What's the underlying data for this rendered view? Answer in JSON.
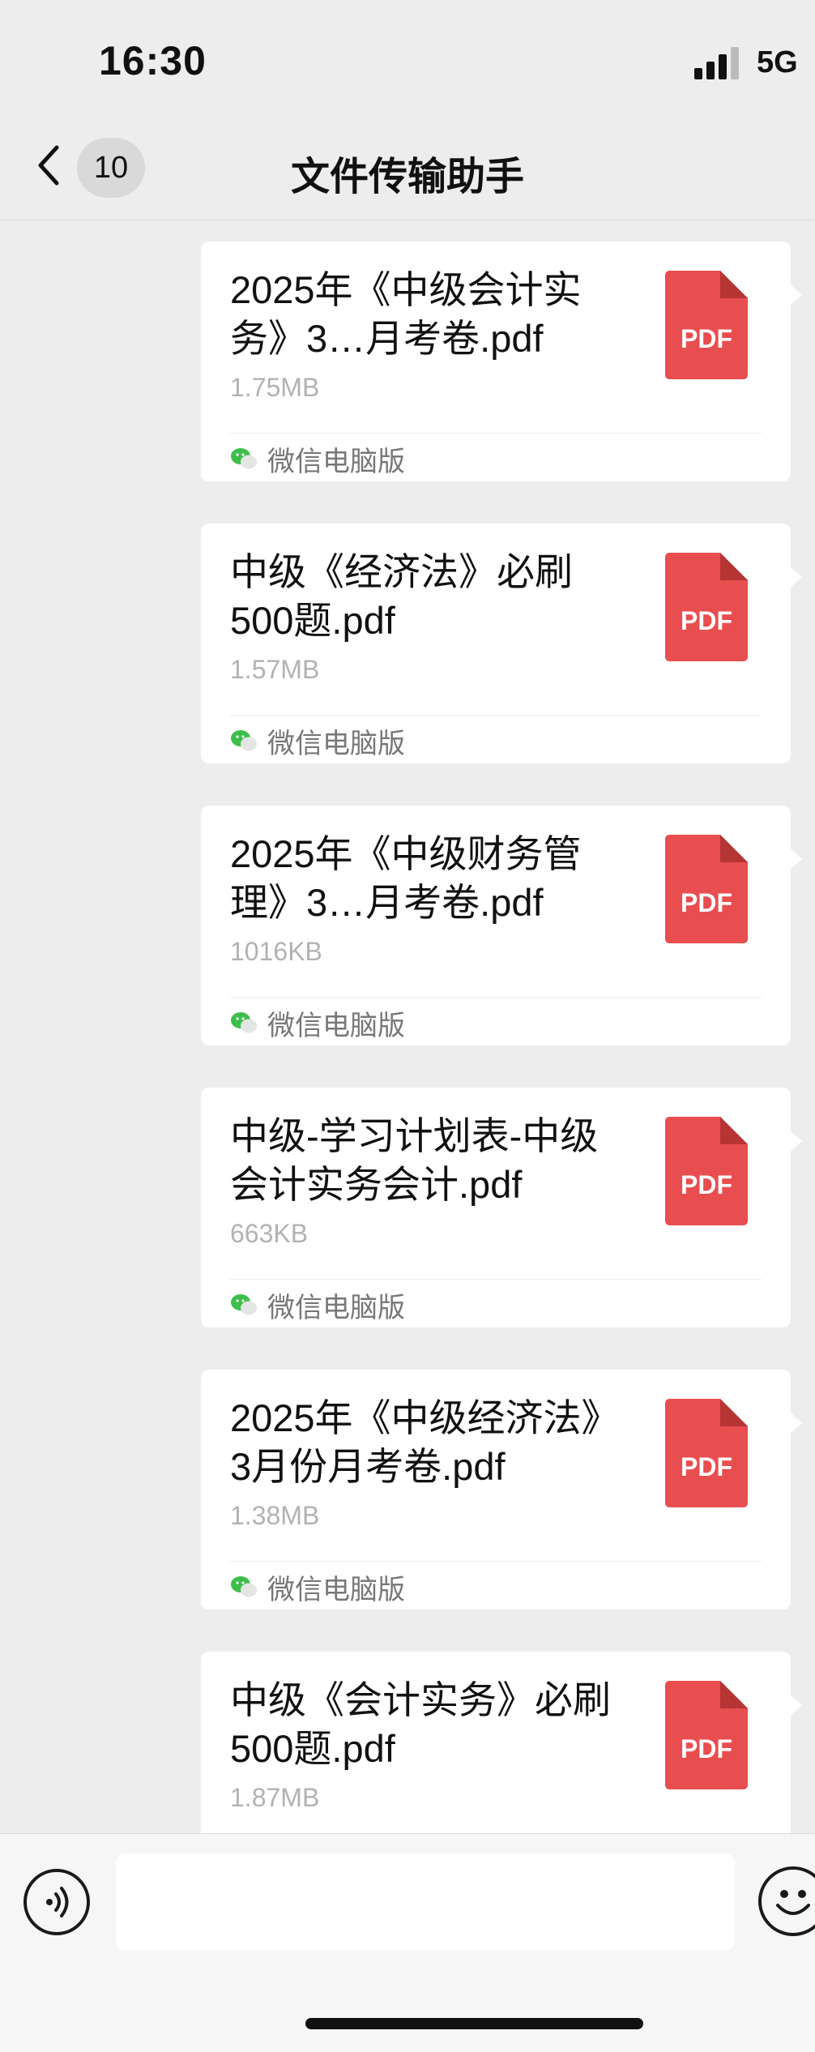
{
  "status_bar": {
    "time": "16:30",
    "network": "5G"
  },
  "nav": {
    "back_count": "10",
    "title": "文件传输助手"
  },
  "messages": [
    {
      "file_name": "2025年《中级会计实务》3…月考卷.pdf",
      "file_size": "1.75MB",
      "file_type": "PDF",
      "source": "微信电脑版"
    },
    {
      "file_name": "中级《经济法》必刷500题.pdf",
      "file_size": "1.57MB",
      "file_type": "PDF",
      "source": "微信电脑版"
    },
    {
      "file_name": "2025年《中级财务管理》3…月考卷.pdf",
      "file_size": "1016KB",
      "file_type": "PDF",
      "source": "微信电脑版"
    },
    {
      "file_name": "中级-学习计划表-中级会计实务会计.pdf",
      "file_size": "663KB",
      "file_type": "PDF",
      "source": "微信电脑版"
    },
    {
      "file_name": "2025年《中级经济法》3月份月考卷.pdf",
      "file_size": "1.38MB",
      "file_type": "PDF",
      "source": "微信电脑版"
    },
    {
      "file_name": "中级《会计实务》必刷500题.pdf",
      "file_size": "1.87MB",
      "file_type": "PDF",
      "source": ""
    }
  ],
  "colors": {
    "pdf_red": "#e84e4f",
    "wechat_green": "#3dbe4b",
    "background": "#ededed"
  },
  "icons": {
    "back": "chevron-left-icon",
    "voice": "voice-input-icon",
    "emoji": "emoji-icon",
    "source": "wechat-icon"
  }
}
